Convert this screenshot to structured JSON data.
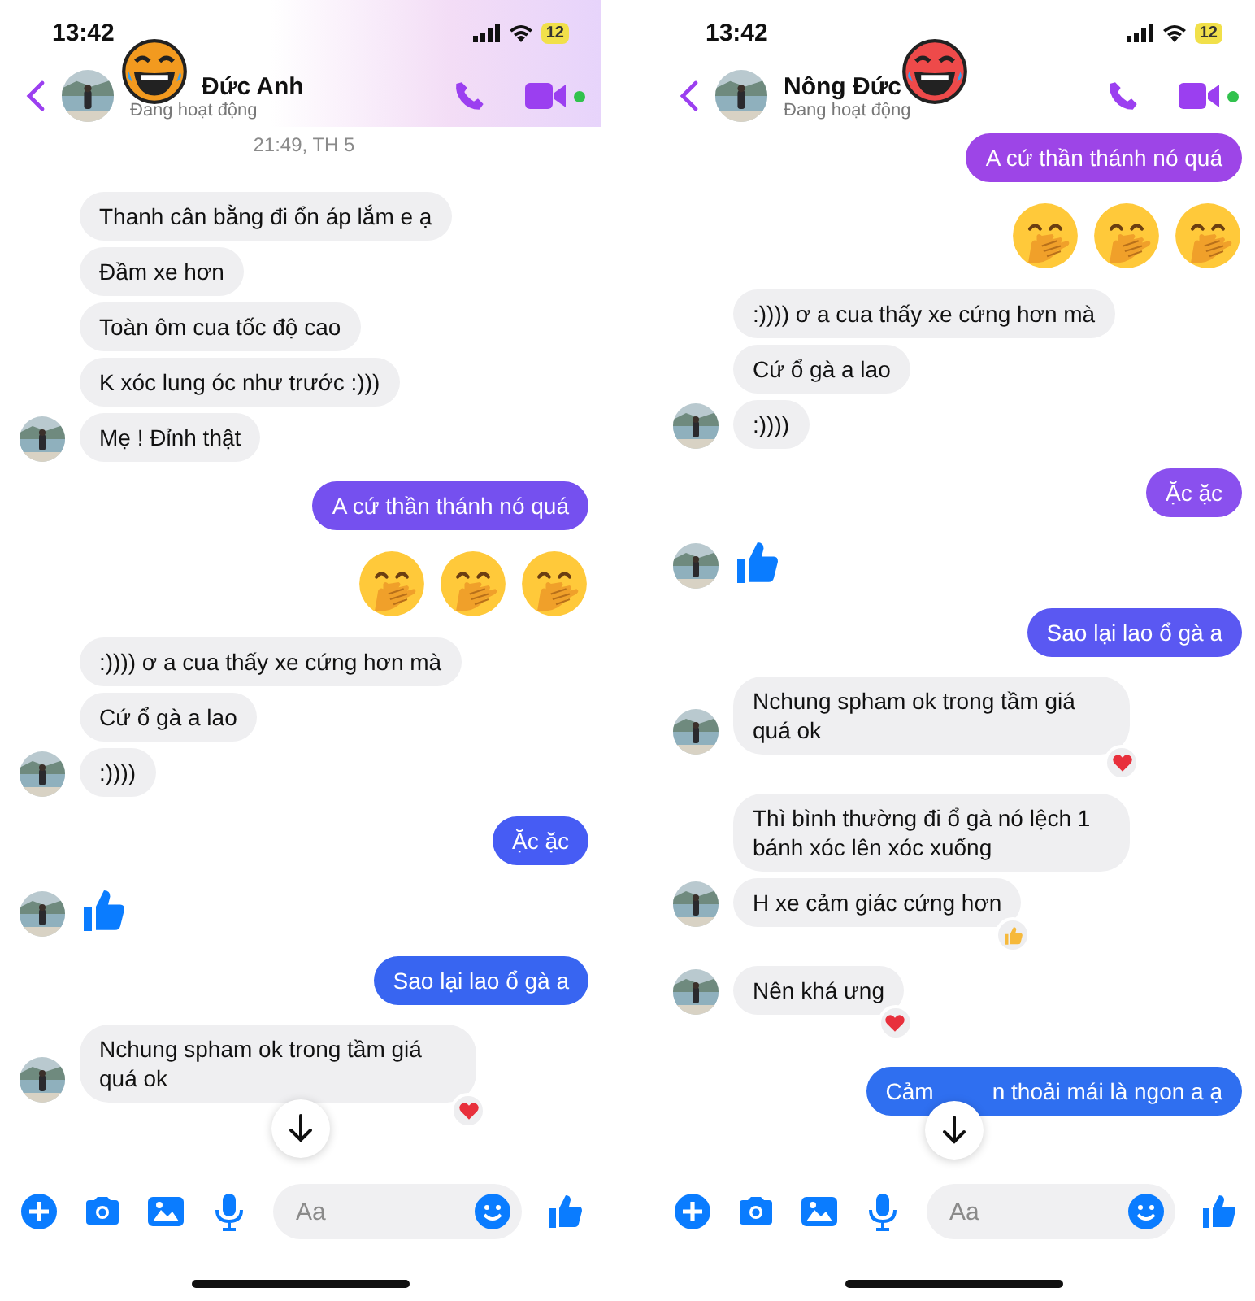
{
  "screens": [
    {
      "status_bar": {
        "time": "13:42",
        "battery": "12"
      },
      "header": {
        "name": "Đức Anh",
        "status": "Đang hoạt động",
        "sticker": {
          "color": "#f29a1f"
        }
      },
      "messages": [
        {
          "kind": "time",
          "text": "21:49, TH 5"
        },
        {
          "kind": "in",
          "text": "Thanh cân bằng đi ổn áp lắm e ạ",
          "avatar": false
        },
        {
          "kind": "in",
          "text": "Đầm xe hơn",
          "avatar": false
        },
        {
          "kind": "in",
          "text": "Toàn ôm cua tốc độ cao",
          "avatar": false
        },
        {
          "kind": "in",
          "text": "K xóc lung óc như trước :)))",
          "avatar": false
        },
        {
          "kind": "in",
          "text": "Mẹ ! Đỉnh thật",
          "avatar": true
        },
        {
          "kind": "out",
          "text": "A cứ thần thánh nó quá",
          "color": "#7550ef"
        },
        {
          "kind": "emoji",
          "emojis": [
            {
              "kind": "hand_over_mouth"
            },
            {
              "kind": "hand_over_mouth"
            },
            {
              "kind": "hand_over_mouth"
            }
          ]
        },
        {
          "kind": "in",
          "text": ":)))) ơ a cua thấy xe cứng hơn mà",
          "avatar": false
        },
        {
          "kind": "in",
          "text": "Cứ ổ gà a lao",
          "avatar": false
        },
        {
          "kind": "in",
          "text": ":))))",
          "avatar": true
        },
        {
          "kind": "out",
          "text": "Ặc ặc",
          "color": "#465cf4"
        },
        {
          "kind": "like",
          "avatar": true
        },
        {
          "kind": "out",
          "text": "Sao lại lao ổ gà a",
          "color": "#3865f1"
        },
        {
          "kind": "in",
          "text": "Nchung spham ok trong tầm giá quá ok",
          "avatar": true,
          "reaction": {
            "kind": "heart"
          }
        }
      ],
      "composer": {
        "placeholder": "Aa"
      }
    },
    {
      "status_bar": {
        "time": "13:42",
        "battery": "12"
      },
      "header": {
        "name": "Nông Đức",
        "status": "Đang hoạt động",
        "sticker": {
          "color": "#ee4a4a"
        }
      },
      "messages": [
        {
          "kind": "out",
          "text": "A cứ thần thánh nó quá",
          "color": "#9d45e7"
        },
        {
          "kind": "emoji",
          "emojis": [
            {
              "kind": "hand_over_mouth"
            },
            {
              "kind": "hand_over_mouth"
            },
            {
              "kind": "hand_over_mouth"
            }
          ]
        },
        {
          "kind": "in",
          "text": ":)))) ơ a cua thấy xe cứng hơn mà",
          "avatar": false
        },
        {
          "kind": "in",
          "text": "Cứ ổ gà a lao",
          "avatar": false
        },
        {
          "kind": "in",
          "text": ":))))",
          "avatar": true
        },
        {
          "kind": "out",
          "text": "Ặc ặc",
          "color": "#8a50ee"
        },
        {
          "kind": "like",
          "avatar": true
        },
        {
          "kind": "out",
          "text": "Sao lại lao ổ gà a",
          "color": "#5a58f2"
        },
        {
          "kind": "in",
          "text": "Nchung spham ok trong tầm giá quá ok",
          "avatar": true,
          "reaction": {
            "kind": "heart"
          }
        },
        {
          "kind": "in",
          "text": "Thì bình thường đi ổ gà nó lệch 1 bánh xóc lên xóc xuống",
          "avatar": false
        },
        {
          "kind": "in",
          "text": "H xe cảm giác cứng hơn",
          "avatar": true,
          "reaction": {
            "kind": "thumb"
          }
        },
        {
          "kind": "in",
          "text": "Nên khá ưng",
          "avatar": true,
          "reaction": {
            "kind": "heart"
          }
        },
        {
          "kind": "out",
          "text_parts": [
            "Cảm",
            "n thoải mái là ngon a ạ"
          ],
          "color": "#2f6ff0"
        }
      ],
      "composer": {
        "placeholder": "Aa"
      }
    }
  ]
}
